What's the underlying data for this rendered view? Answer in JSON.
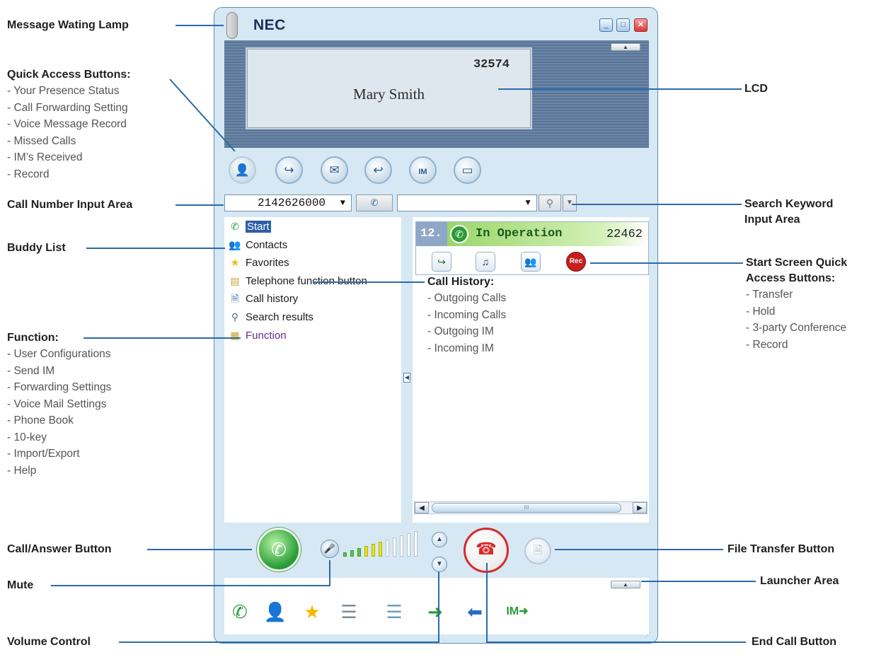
{
  "window": {
    "logo": "NEC",
    "min_icon": "minimize-icon",
    "max_icon": "maximize-icon",
    "close_icon": "close-icon"
  },
  "lcd": {
    "number": "32574",
    "name": "Mary Smith"
  },
  "quick_access_icons": [
    "presence-status-icon",
    "call-forwarding-icon",
    "voice-message-icon",
    "missed-calls-icon",
    "im-received-icon",
    "record-icon"
  ],
  "call_input": {
    "value": "2142626000",
    "dropdown_glyph": "▼"
  },
  "search_input": {
    "value": "",
    "dropdown_glyph": "▼"
  },
  "buddy_list": [
    {
      "label": "Start",
      "icon": "start-icon",
      "selected": true
    },
    {
      "label": "Contacts",
      "icon": "contacts-icon"
    },
    {
      "label": "Favorites",
      "icon": "star-icon"
    },
    {
      "label": "Telephone function button",
      "icon": "telephone-function-icon"
    },
    {
      "label": "Call history",
      "icon": "call-history-icon"
    },
    {
      "label": "Search results",
      "icon": "search-results-icon"
    },
    {
      "label": "Function",
      "icon": "function-icon"
    }
  ],
  "call_card": {
    "index": "12.",
    "status": "In Operation",
    "extension": "22462",
    "buttons": [
      "transfer-icon",
      "hold-icon",
      "conference-icon",
      "record-icon"
    ],
    "rec_label": "Rec"
  },
  "scrollbar": {
    "thumb_grip": "III"
  },
  "volume": {
    "level_bars_lit": 6,
    "level_bars_total": 11
  },
  "launcher_icons": [
    "start-icon",
    "contacts-icon",
    "favorites-star-icon",
    "phonebook-icon",
    "phonebook-2-icon",
    "outgoing-call-icon",
    "incoming-call-icon",
    "outgoing-im-icon"
  ],
  "annotations": {
    "message_lamp": "Message Wating Lamp",
    "quick_access": {
      "title": "Quick Access Buttons:",
      "items": [
        "- Your Presence Status",
        "- Call Forwarding Setting",
        "- Voice Message Record",
        "- Missed Calls",
        "- IM’s Received",
        "- Record"
      ]
    },
    "call_number_input": "Call Number Input Area",
    "buddy_list": "Buddy List",
    "function": {
      "title": "Function:",
      "items": [
        "- User Configurations",
        "- Send IM",
        "- Forwarding Settings",
        "- Voice Mail Settings",
        "- Phone Book",
        "- 10-key",
        "- Import/Export",
        "- Help"
      ]
    },
    "call_answer": "Call/Answer Button",
    "mute": "Mute",
    "volume_control": "Volume Control",
    "lcd": "LCD",
    "search_keyword": [
      "Search Keyword",
      "Input Area"
    ],
    "start_screen": {
      "title": [
        "Start Screen Quick",
        "Access Buttons:"
      ],
      "items": [
        "- Transfer",
        "- Hold",
        "- 3-party Conference",
        "- Record"
      ]
    },
    "call_history": {
      "title": "Call History:",
      "items": [
        "- Outgoing Calls",
        "- Incoming Calls",
        "- Outgoing IM",
        "- Incoming IM"
      ]
    },
    "file_transfer": "File Transfer Button",
    "launcher_area": "Launcher Area",
    "end_call": "End Call Button"
  }
}
